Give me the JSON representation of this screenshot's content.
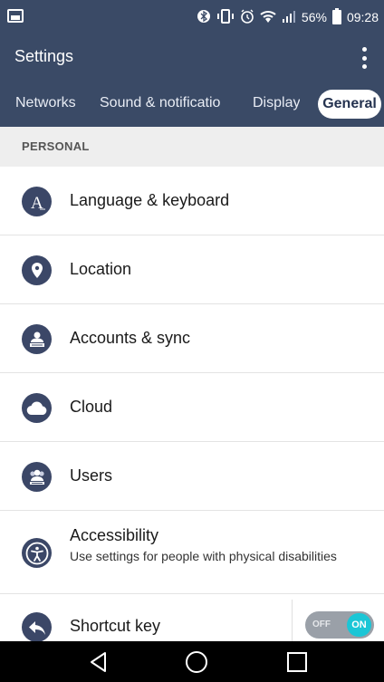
{
  "status_bar": {
    "battery_percent": "56%",
    "time": "09:28",
    "icons": [
      "image-icon",
      "bluetooth-icon",
      "vibrate-icon",
      "alarm-icon",
      "wifi-icon",
      "signal-icon",
      "battery-icon"
    ]
  },
  "app_bar": {
    "title": "Settings",
    "menu_icon": "more-vert-icon"
  },
  "tabs": [
    {
      "label": "Networks",
      "active": false
    },
    {
      "label": "Sound & notificatio",
      "active": false
    },
    {
      "label": "Display",
      "active": false
    },
    {
      "label": "General",
      "active": true
    }
  ],
  "section": {
    "header": "PERSONAL"
  },
  "items": [
    {
      "label": "Language & keyboard",
      "icon": "language-icon"
    },
    {
      "label": "Location",
      "icon": "location-pin-icon"
    },
    {
      "label": "Accounts & sync",
      "icon": "accounts-icon"
    },
    {
      "label": "Cloud",
      "icon": "cloud-icon"
    },
    {
      "label": "Users",
      "icon": "users-icon"
    },
    {
      "label": "Accessibility",
      "subtitle": "Use settings for people with physical disabilities",
      "icon": "accessibility-icon"
    },
    {
      "label": "Shortcut key",
      "icon": "shortcut-icon",
      "toggle": {
        "off_label": "OFF",
        "on_label": "ON",
        "state": "on"
      }
    }
  ],
  "colors": {
    "header_bg": "#3a4a66",
    "icon_bg": "#3b4767",
    "toggle_on": "#1bc6d6",
    "section_bg": "#eeeeee"
  },
  "nav_bar": {
    "icons": [
      "back-icon",
      "home-icon",
      "recents-icon"
    ]
  }
}
